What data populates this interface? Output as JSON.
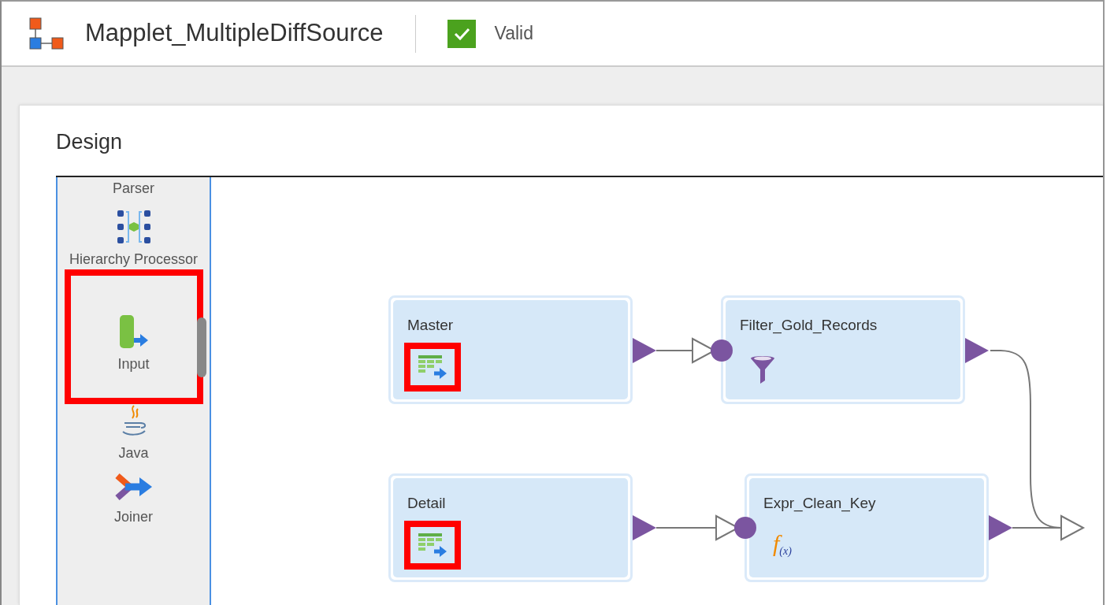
{
  "header": {
    "title": "Mapplet_MultipleDiffSource",
    "status": {
      "label": "Valid",
      "valid": true
    }
  },
  "panel": {
    "title": "Design"
  },
  "palette": [
    {
      "label": "Parser",
      "kind": "parser",
      "highlighted": false
    },
    {
      "label": "Hierarchy Processor",
      "kind": "hierarchy",
      "highlighted": false
    },
    {
      "label": "Input",
      "kind": "input",
      "highlighted": true
    },
    {
      "label": "Java",
      "kind": "java",
      "highlighted": false
    },
    {
      "label": "Joiner",
      "kind": "joiner",
      "highlighted": false
    }
  ],
  "nodes": [
    {
      "name": "Master",
      "kind": "source",
      "icon_highlighted": true
    },
    {
      "name": "Filter_Gold_Records",
      "kind": "filter",
      "icon_highlighted": false
    },
    {
      "name": "Detail",
      "kind": "source",
      "icon_highlighted": true
    },
    {
      "name": "Expr_Clean_Key",
      "kind": "expression",
      "symbol": "f$_{(x)}$",
      "icon_highlighted": false
    }
  ]
}
